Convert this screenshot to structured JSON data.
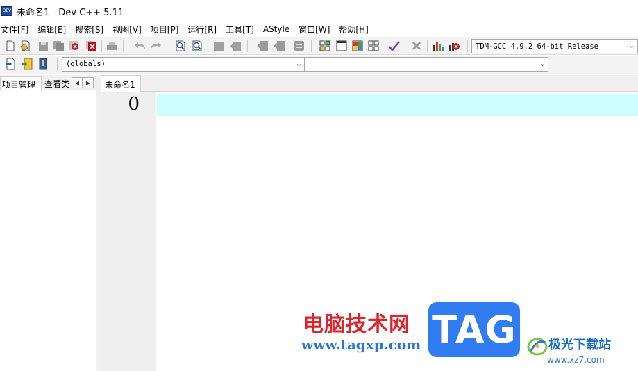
{
  "window": {
    "title": "未命名1 - Dev-C++ 5.11",
    "icon_label": "DEV"
  },
  "menu": {
    "items": [
      {
        "label": "文件[F]"
      },
      {
        "label": "编辑[E]"
      },
      {
        "label": "搜索[S]"
      },
      {
        "label": "视图[V]"
      },
      {
        "label": "项目[P]"
      },
      {
        "label": "运行[R]"
      },
      {
        "label": "工具[T]"
      },
      {
        "label": "AStyle"
      },
      {
        "label": "窗口[W]"
      },
      {
        "label": "帮助[H]"
      }
    ]
  },
  "toolbar": {
    "compiler": "TDM-GCC 4.9.2 64-bit Release",
    "icons": [
      "new-file-icon",
      "open-file-icon",
      "save-icon",
      "save-all-icon",
      "close-icon",
      "close-all-icon",
      "print-icon",
      "undo-icon",
      "redo-icon",
      "find-icon",
      "replace-icon",
      "indent-icon",
      "unindent-icon",
      "bookmark-prev-icon",
      "bookmark-next-icon",
      "goto-line-icon",
      "compile-icon",
      "run-icon",
      "compile-run-icon",
      "rebuild-icon",
      "syntax-check-icon",
      "stop-icon",
      "chart-icon",
      "debug-icon"
    ]
  },
  "classbar": {
    "scope": "(globals)",
    "function": ""
  },
  "left_panel": {
    "tabs": [
      {
        "label": "项目管理"
      },
      {
        "label": "查看类"
      }
    ]
  },
  "editor": {
    "tab_label": "未命名1",
    "line_number": "0"
  },
  "watermark": {
    "cn_text": "电脑技术网",
    "url": "www.tagxp.com",
    "tag": "TAG",
    "site_name": "极光下载站",
    "site_url": "www.xz7.com"
  },
  "colors": {
    "current_line": "#ccfffe",
    "gutter": "#efefef",
    "watermark_red": "#e0232a",
    "watermark_blue": "#2f7df0"
  }
}
